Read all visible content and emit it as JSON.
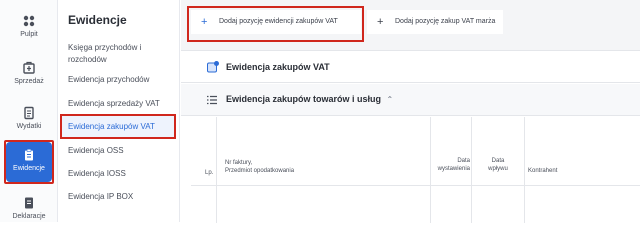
{
  "rail": {
    "items": [
      {
        "label": "Pulpit",
        "icon": "grid-icon"
      },
      {
        "label": "Sprzedaż",
        "icon": "sales-icon"
      },
      {
        "label": "Wydatki",
        "icon": "expenses-icon"
      },
      {
        "label": "Ewidencje",
        "icon": "clipboard-icon"
      },
      {
        "label": "Deklaracje",
        "icon": "declarations-icon"
      }
    ],
    "active_color": "#2b6bd6"
  },
  "subnav": {
    "title": "Ewidencje",
    "items": [
      {
        "label": "Księga przychodów i rozchodów"
      },
      {
        "label": "Ewidencja przychodów"
      },
      {
        "label": "Ewidencja sprzedaży VAT"
      },
      {
        "label": "Ewidencja zakupów VAT"
      },
      {
        "label": "Ewidencja OSS"
      },
      {
        "label": "Ewidencja IOSS"
      },
      {
        "label": "Ewidencja IP BOX"
      }
    ]
  },
  "toolbar": {
    "add_vat_purchase": "Dodaj pozycję ewidencji zakupów VAT",
    "add_vat_margin": "Dodaj pozycję zakup VAT marża"
  },
  "panel": {
    "title": "Ewidencja zakupów VAT",
    "subtitle": "Ewidencja zakupów towarów i usług"
  },
  "table": {
    "headers": {
      "lp": "Lp.",
      "invoice": "Nr faktury,\nPrzedmiot opodatkowania",
      "issue_date": "Data\nwystawienia",
      "receipt_date": "Data\nwpływu",
      "contractor": "Kontrahent"
    }
  },
  "highlight_color": "#d0271d"
}
